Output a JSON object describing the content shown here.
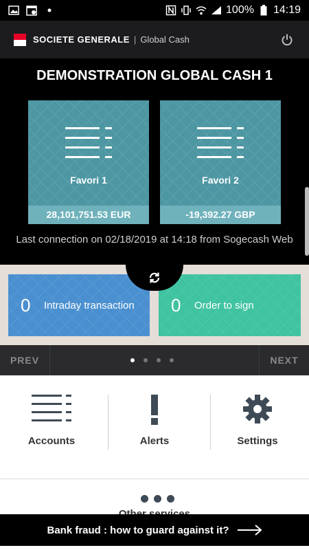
{
  "status_bar": {
    "battery": "100%",
    "time": "14:19"
  },
  "header": {
    "brand": "SOCIETE GENERALE",
    "separator": "|",
    "product": "Global Cash"
  },
  "hero": {
    "company": "DEMONSTRATION GLOBAL CASH 1",
    "favorites": [
      {
        "label": "Favori 1",
        "amount": "28,101,751.53 EUR"
      },
      {
        "label": "Favori 2",
        "amount": "-19,392.27 GBP"
      }
    ],
    "last_connection": "Last connection on 02/18/2019 at 14:18 from Sogecash Web"
  },
  "tiles": [
    {
      "count": "0",
      "label": "Intraday transaction",
      "color": "#4a90d0"
    },
    {
      "count": "0",
      "label": "Order to sign",
      "color": "#3fc3a0"
    }
  ],
  "pager": {
    "prev": "PREV",
    "next": "NEXT",
    "pages": 4,
    "current_page": 1
  },
  "shortcuts": [
    {
      "label": "Accounts",
      "icon": "list-icon"
    },
    {
      "label": "Alerts",
      "icon": "exclamation-icon"
    },
    {
      "label": "Settings",
      "icon": "gear-icon"
    }
  ],
  "other_services": {
    "label": "Other services",
    "icon": "more-dots-icon"
  },
  "fraud_banner": {
    "text": "Bank fraud : how to guard against it?"
  },
  "colors": {
    "brand_red": "#e60028",
    "card_teal": "#4d97a3",
    "tile_blue": "#4a90d0",
    "tile_green": "#3fc3a0"
  }
}
